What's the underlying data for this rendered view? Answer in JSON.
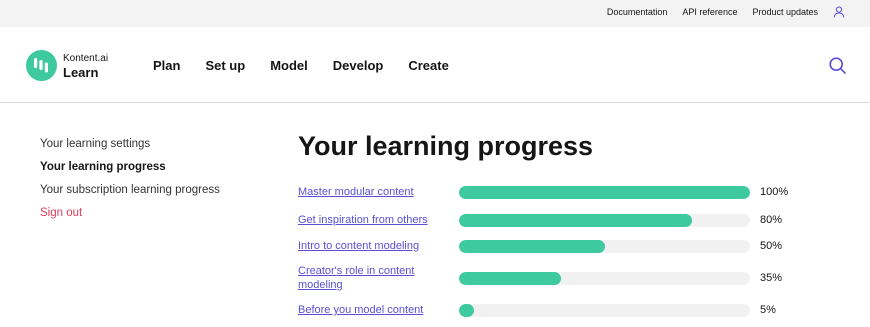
{
  "topbar": {
    "links": [
      "Documentation",
      "API reference",
      "Product updates"
    ],
    "user_icon": "user-icon"
  },
  "brand": {
    "name": "Kontent.ai",
    "product": "Learn",
    "logo_color": "#3ec99e"
  },
  "main_nav": [
    "Plan",
    "Set up",
    "Model",
    "Develop",
    "Create"
  ],
  "search_icon": "search-icon",
  "sidebar": {
    "items": [
      {
        "label": "Your learning settings"
      },
      {
        "label": "Your learning progress"
      },
      {
        "label": "Your subscription learning progress"
      },
      {
        "label": "Sign out"
      }
    ]
  },
  "main": {
    "title": "Your learning progress",
    "progress": [
      {
        "label": "Master modular content",
        "percent": 100,
        "percent_label": "100%"
      },
      {
        "label": "Get inspiration from others",
        "percent": 80,
        "percent_label": "80%"
      },
      {
        "label": "Intro to content modeling",
        "percent": 50,
        "percent_label": "50%"
      },
      {
        "label": "Creator's role in content modeling",
        "percent": 35,
        "percent_label": "35%"
      },
      {
        "label": "Before you model content",
        "percent": 5,
        "percent_label": "5%"
      }
    ]
  },
  "colors": {
    "accent_green": "#3ec99e",
    "link_purple": "#5b4fd6",
    "sign_out_red": "#db3b5c"
  }
}
